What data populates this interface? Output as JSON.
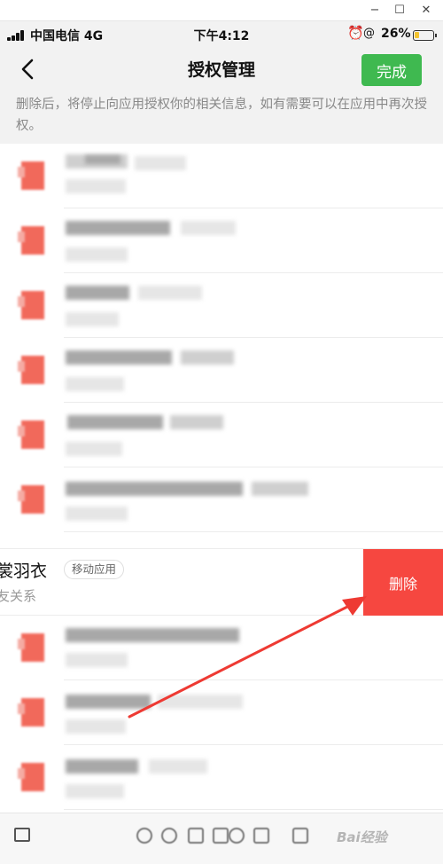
{
  "window": {
    "minimize": "−",
    "maximize": "☐",
    "close": "✕"
  },
  "status_bar": {
    "carrier": "中国电信 4G",
    "time": "下午4:12",
    "battery_percent": "26%",
    "battery_level": 0.26
  },
  "nav": {
    "back_icon": "chevron-left-icon",
    "title": "授权管理",
    "done_label": "完成",
    "accent": "#3fb950"
  },
  "notice": {
    "text": "删除后，将停止向应用授权你的相关信息，如有需要可以在应用中再次授权。"
  },
  "swiped_item": {
    "name": "裳羽衣",
    "tag": "移动应用",
    "subtitle": "友关系",
    "delete_label": "删除",
    "delete_color": "#f64740"
  },
  "bottom_bar": {
    "watermark": "Bai经验"
  },
  "colors": {
    "arrow": "#ee3a33",
    "icon": "#f0594a",
    "background": "#f2f2f2"
  }
}
